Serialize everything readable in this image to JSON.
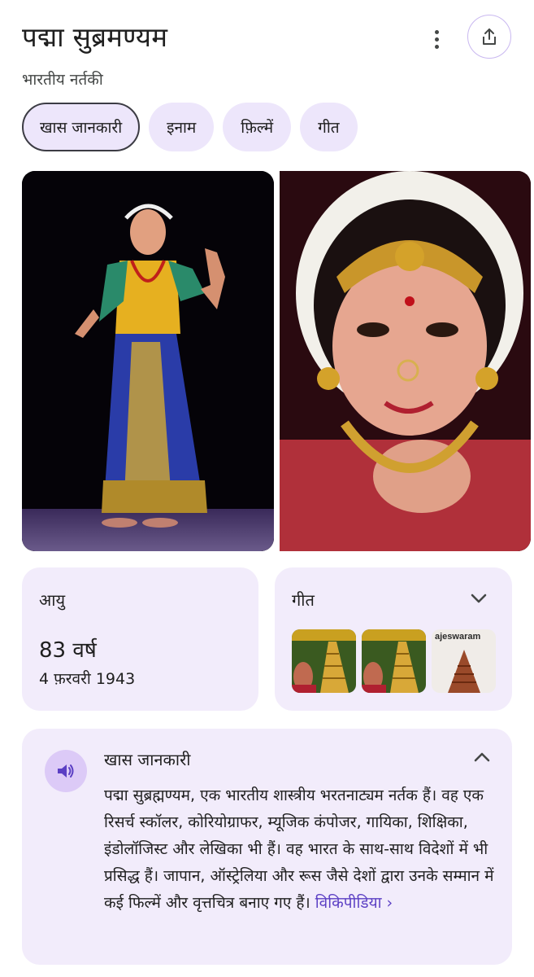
{
  "entity": {
    "title": "पद्मा सुब्रमण्यम",
    "subtitle": "भारतीय नर्तकी"
  },
  "actions": {
    "more_icon": "more-vert-icon",
    "share_icon": "share-icon"
  },
  "tabs": [
    {
      "label": "खास जानकारी",
      "active": true
    },
    {
      "label": "इनाम",
      "active": false
    },
    {
      "label": "फ़िल्में",
      "active": false
    },
    {
      "label": "गीत",
      "active": false
    }
  ],
  "age": {
    "label": "आयु",
    "value": "83 वर्ष",
    "dob": "4 फ़रवरी 1943"
  },
  "songs": {
    "label": "गीत",
    "thumb_caption": "ajeswaram"
  },
  "overview": {
    "label": "खास जानकारी",
    "text": "पद्मा सुब्रह्मण्यम, एक भारतीय शास्त्रीय भरतनाट्यम नर्तक हैं। वह एक रिसर्च स्कॉलर, कोरियोग्राफर, म्यूजिक कंपोजर, गायिका, शिक्षिका, इंडोलॉजिस्ट और लेखिका भी हैं। वह भारत के साथ-साथ विदेशों में भी प्रसिद्ध हैं। जापान, ऑस्ट्रेलिया और रूस जैसे देशों द्वारा उनके सम्मान में कई फिल्में और वृत्तचित्र बनाए गए हैं।",
    "link_label": "विकिपीडिया ›"
  },
  "colors": {
    "accent": "#5b3fc4",
    "card_bg": "#f2ecfb",
    "chip_bg": "#ede6fb",
    "speaker_bg": "#dccaf7"
  }
}
